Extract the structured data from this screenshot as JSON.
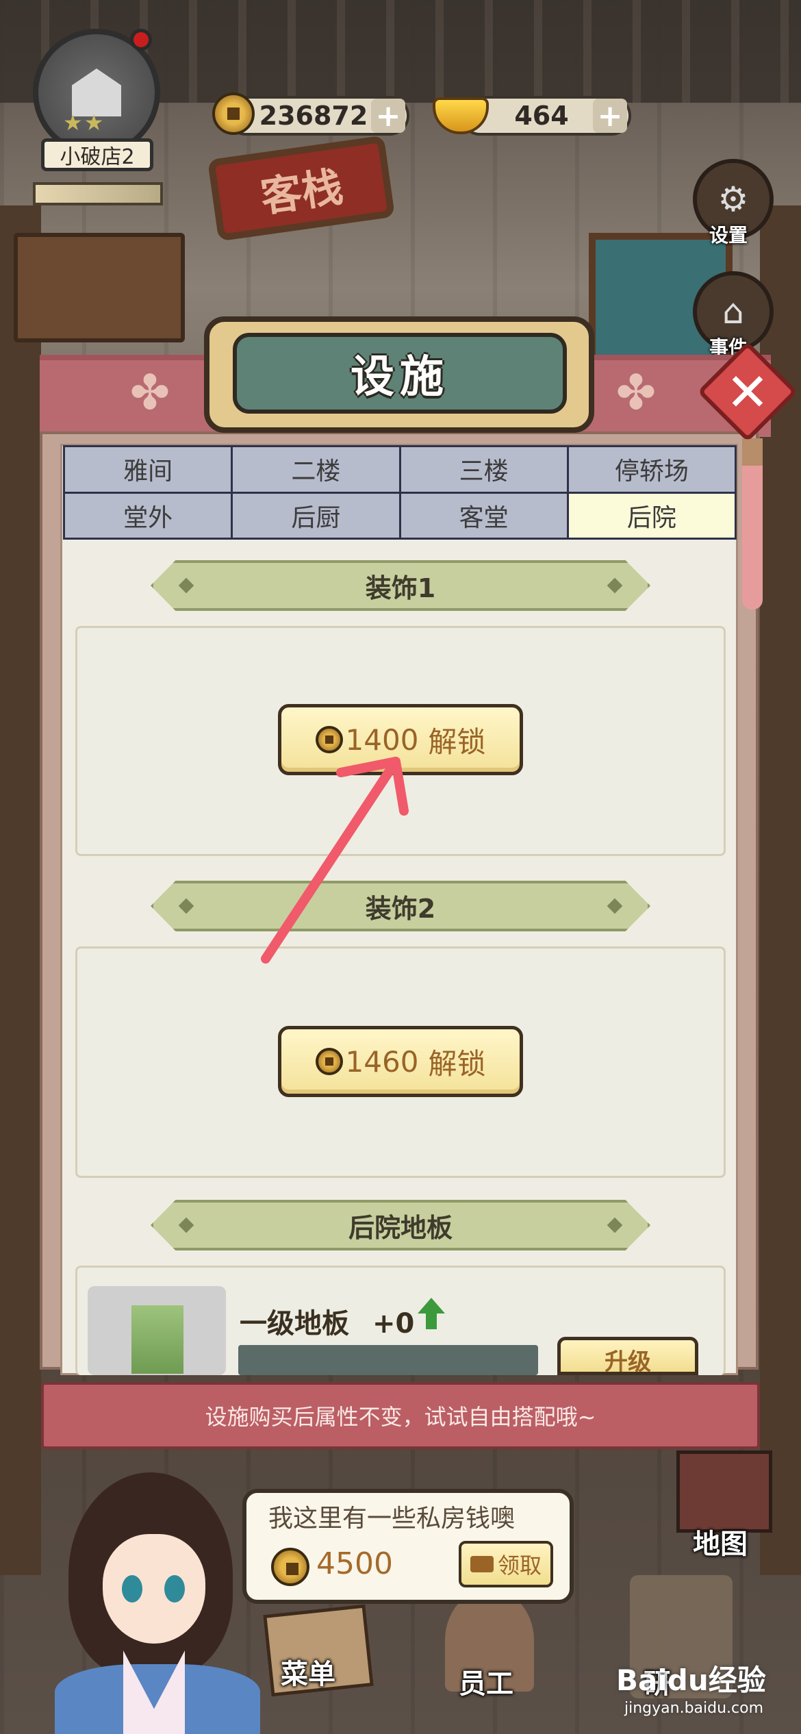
{
  "hud": {
    "shop_name": "小破店2",
    "stars": "★★",
    "copper_coins": "236872",
    "gold_ingots": "464",
    "plus": "+"
  },
  "side_buttons": {
    "settings_label": "设置",
    "events_label": "事件",
    "map_label": "地图"
  },
  "background": {
    "inn_sign": "客栈"
  },
  "dialog": {
    "title": "设施",
    "tabs": [
      {
        "label": "雅间",
        "active": false
      },
      {
        "label": "二楼",
        "active": false
      },
      {
        "label": "三楼",
        "active": false
      },
      {
        "label": "停轿场",
        "active": false
      },
      {
        "label": "堂外",
        "active": false
      },
      {
        "label": "后厨",
        "active": false
      },
      {
        "label": "客堂",
        "active": false
      },
      {
        "label": "后院",
        "active": true
      }
    ],
    "sections": [
      {
        "title": "装饰1",
        "unlock_cost": "1400",
        "unlock_label": "解锁"
      },
      {
        "title": "装饰2",
        "unlock_cost": "1460",
        "unlock_label": "解锁"
      },
      {
        "title": "后院地板"
      }
    ],
    "floor_item": {
      "name": "一级地板",
      "bonus": "+0",
      "upgrade_label": "升级"
    },
    "footer_hint": "设施购买后属性不变，试试自由搭配哦~"
  },
  "offer": {
    "text": "我这里有一些私房钱噢",
    "amount": "4500",
    "claim_label": "领取"
  },
  "bottom_nav": {
    "menu_label": "菜单",
    "staff_label": "员工",
    "research_label": "研"
  },
  "watermark": {
    "brand": "Baidu经验",
    "url": "jingyan.baidu.com"
  },
  "colors": {
    "dialog_pink": "#b86a70",
    "tab_active": "#fbfad9",
    "tab_inactive": "#b7bccd",
    "section_green": "#c7cf9f",
    "coin_text": "#9a6427",
    "annotation_arrow": "#f05a6a"
  }
}
